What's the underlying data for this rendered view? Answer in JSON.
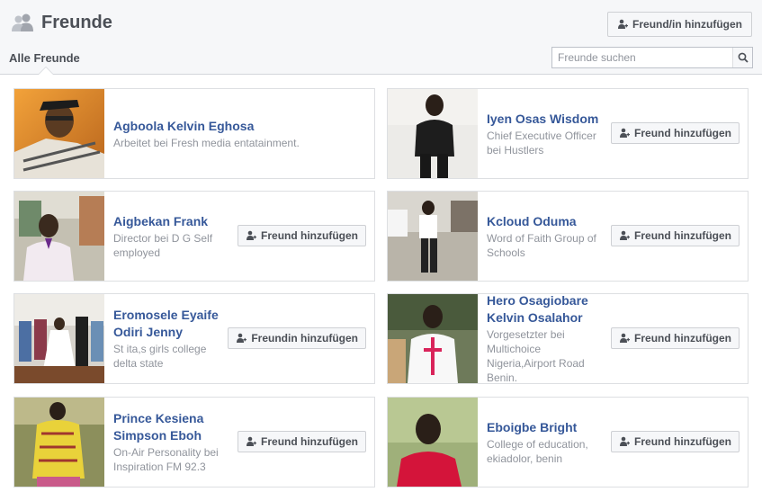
{
  "header": {
    "title": "Freunde",
    "add_friend_label": "Freund/in hinzufügen",
    "tab_all": "Alle Freunde",
    "search_placeholder": "Freunde suchen"
  },
  "icons": {
    "friends": "friends-icon",
    "add_person": "add-person-icon",
    "search": "search-icon"
  },
  "colors": {
    "link": "#365899",
    "secondary_text": "#90949c"
  },
  "friends": [
    {
      "name": "Agboola Kelvin Eghosa",
      "sub": "Arbeitet bei Fresh media entatainment.",
      "button": ""
    },
    {
      "name": "Iyen Osas Wisdom",
      "sub": "Chief Executive Officer bei Hustlers",
      "button": "Freund hinzufügen"
    },
    {
      "name": "Aigbekan Frank",
      "sub": "Director bei D G Self employed",
      "button": "Freund hinzufügen"
    },
    {
      "name": "Kcloud Oduma",
      "sub": "Word of Faith Group of Schools",
      "button": "Freund hinzufügen"
    },
    {
      "name": "Eromosele Eyaife Odiri Jenny",
      "sub": "St ita,s girls college delta state",
      "button": "Freundin hinzufügen"
    },
    {
      "name": "Hero Osagiobare Kelvin Osalahor",
      "sub": "Vorgesetzter bei Multichoice Nigeria,Airport Road Benin.",
      "button": "Freund hinzufügen"
    },
    {
      "name": "Prince Kesiena Simpson Eboh",
      "sub": "On-Air Personality bei Inspiration FM 92.3",
      "button": "Freund hinzufügen"
    },
    {
      "name": "Eboigbe Bright",
      "sub": "College of education, ekiadolor, benin",
      "button": "Freund hinzufügen"
    }
  ]
}
